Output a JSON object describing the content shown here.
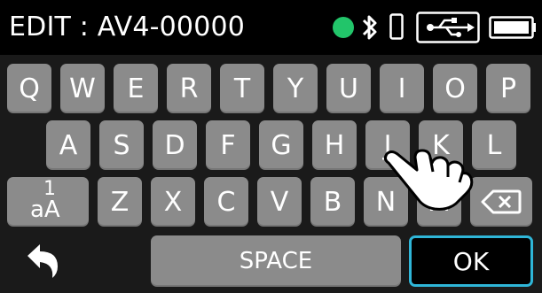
{
  "status_bar": {
    "title": "EDIT : AV4-00000",
    "icons": [
      "recording-indicator-icon",
      "bluetooth-icon",
      "phone-icon",
      "usb-icon",
      "battery-icon"
    ],
    "recording_color": "#22c56a"
  },
  "keyboard": {
    "row1": [
      "Q",
      "W",
      "E",
      "R",
      "T",
      "Y",
      "U",
      "I",
      "O",
      "P"
    ],
    "row2": [
      "A",
      "S",
      "D",
      "F",
      "G",
      "H",
      "J",
      "K",
      "L"
    ],
    "row3_letters": [
      "Z",
      "X",
      "C",
      "V",
      "B",
      "N",
      "M"
    ],
    "shift": {
      "top": "1",
      "bottom": "aA"
    },
    "backspace_icon": "backspace-icon",
    "space_label": "SPACE",
    "ok_label": "OK",
    "back_icon": "back-arrow-icon",
    "key_color": "#8b8b8b",
    "ok_border_color": "#2fb6d8"
  },
  "overlay": {
    "icon": "tapping-hand-icon"
  }
}
